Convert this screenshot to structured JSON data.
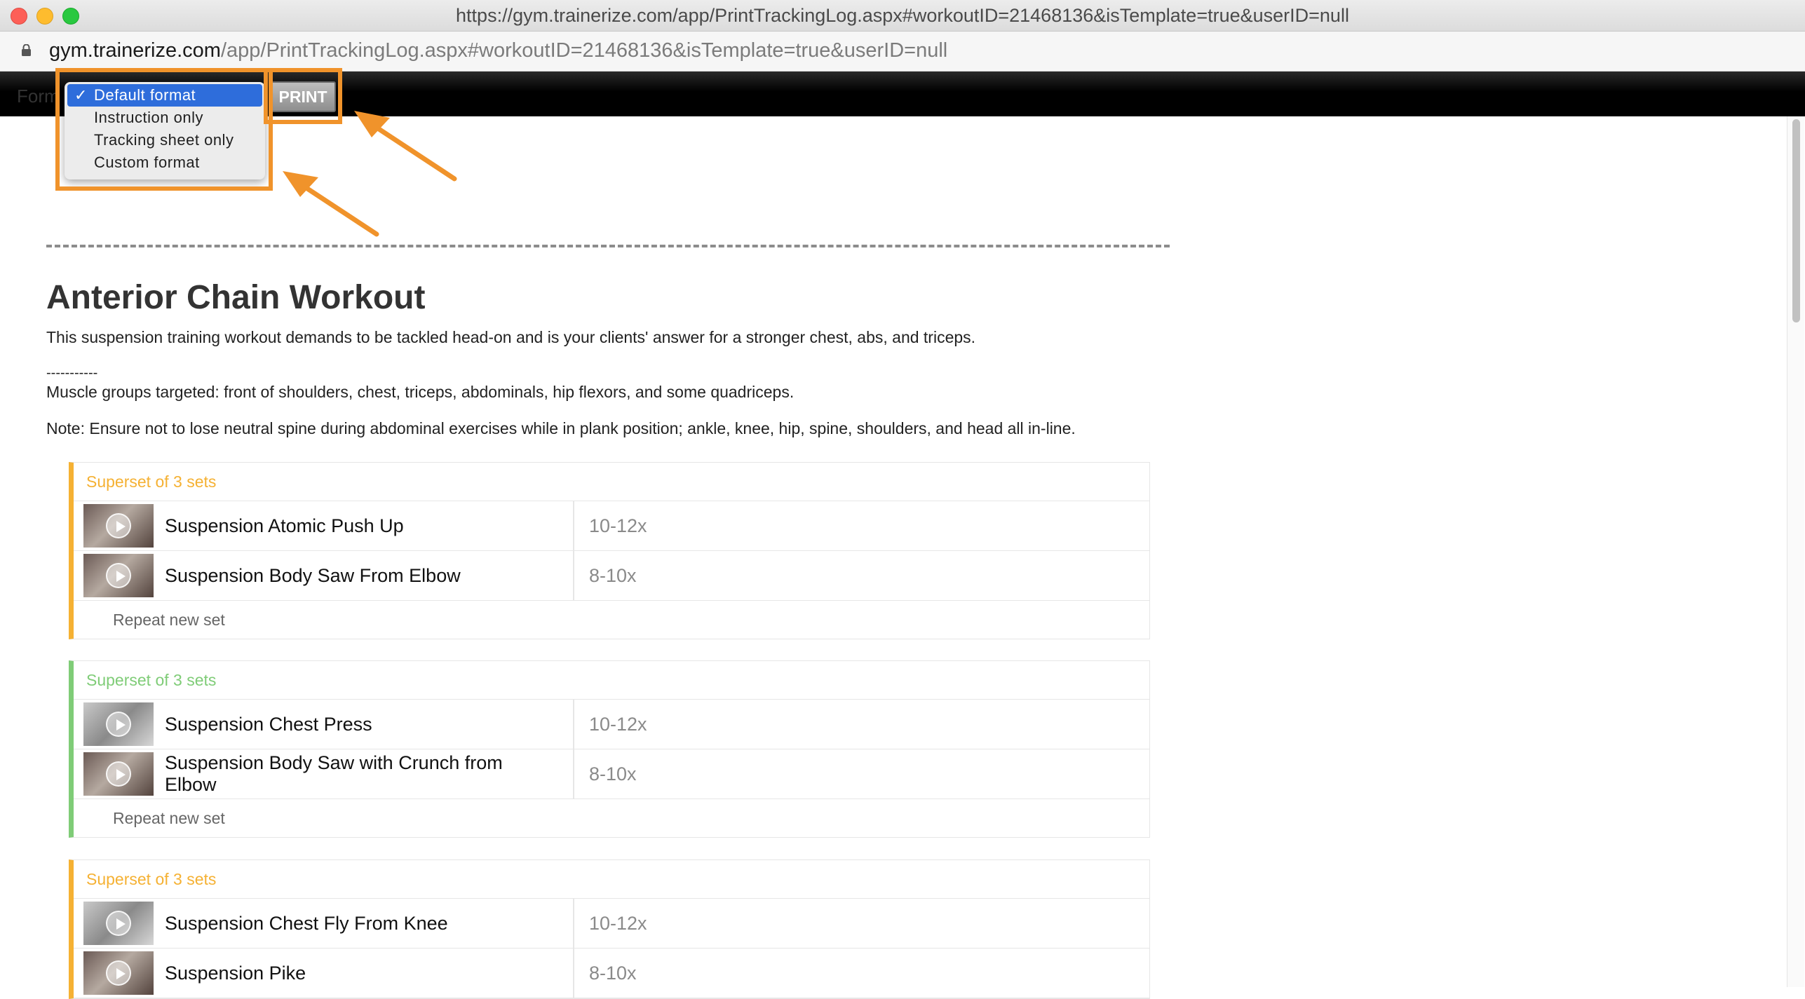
{
  "window": {
    "title": "https://gym.trainerize.com/app/PrintTrackingLog.aspx#workoutID=21468136&isTemplate=true&userID=null"
  },
  "address": {
    "domain": "gym.trainerize.com",
    "path": "/app/PrintTrackingLog.aspx#workoutID=21468136&isTemplate=true&userID=null"
  },
  "toolbar": {
    "format_label": "Form",
    "print_label": "PRINT",
    "format_options": [
      {
        "label": "Default format",
        "selected": true
      },
      {
        "label": "Instruction only",
        "selected": false
      },
      {
        "label": "Tracking sheet only",
        "selected": false
      },
      {
        "label": "Custom format",
        "selected": false
      }
    ]
  },
  "workout": {
    "title": "Anterior Chain Workout",
    "description": "This suspension training workout demands to be tackled head-on and is your clients' answer for a stronger chest, abs, and triceps.",
    "separator": "-----------",
    "muscles": "Muscle groups targeted: front of shoulders, chest, triceps, abdominals, hip flexors, and some quadriceps.",
    "note": "Note: Ensure not to lose neutral spine during abdominal exercises while in plank position; ankle, knee, hip, spine, shoulders, and head all in-line.",
    "supersets": [
      {
        "header": "Superset of 3 sets",
        "color": "#f5b133",
        "repeat_label": "Repeat new set",
        "exercises": [
          {
            "name": "Suspension Atomic Push Up",
            "reps": "10-12x"
          },
          {
            "name": "Suspension Body Saw From Elbow",
            "reps": "8-10x"
          }
        ]
      },
      {
        "header": "Superset of 3 sets",
        "color": "#7fcc77",
        "repeat_label": "Repeat new set",
        "exercises": [
          {
            "name": "Suspension Chest Press",
            "reps": "10-12x"
          },
          {
            "name": "Suspension Body Saw with Crunch from Elbow",
            "reps": "8-10x"
          }
        ]
      },
      {
        "header": "Superset of 3 sets",
        "color": "#f5b133",
        "exercises": [
          {
            "name": "Suspension Chest Fly From Knee",
            "reps": "10-12x"
          },
          {
            "name": "Suspension Pike",
            "reps": "8-10x"
          }
        ]
      }
    ]
  },
  "colors": {
    "annotation": "#f0932b",
    "selection": "#2e6ddb"
  }
}
